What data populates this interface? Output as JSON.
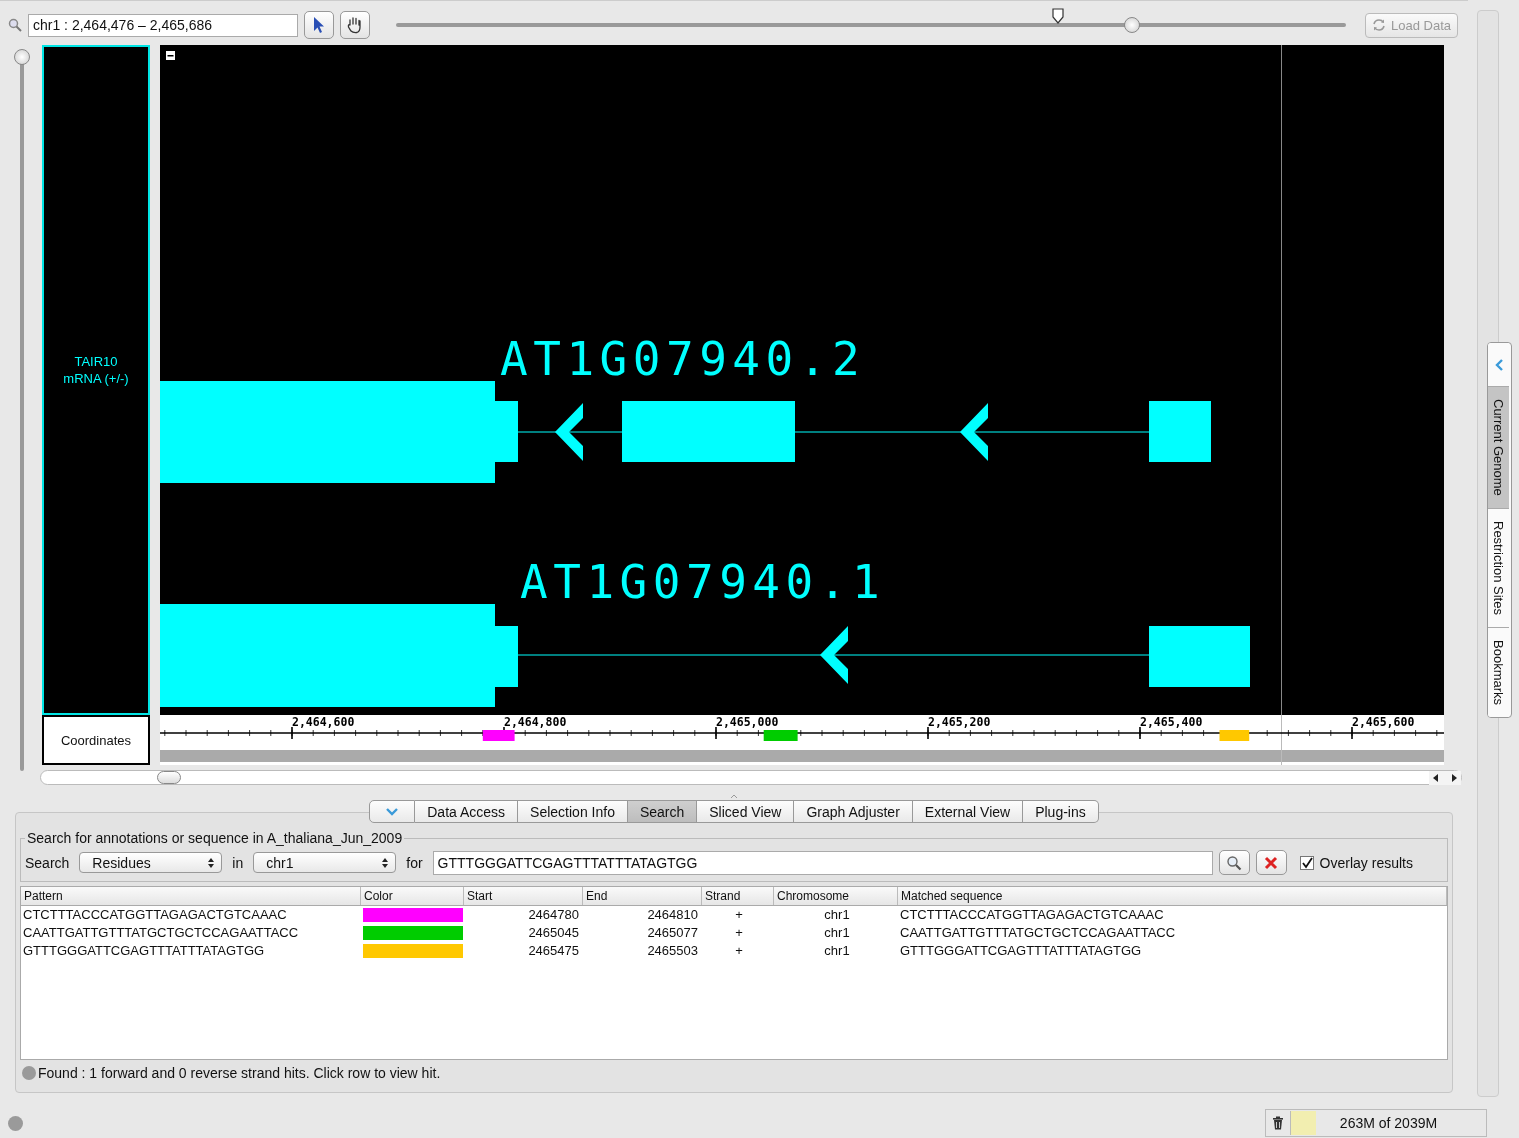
{
  "toolbar": {
    "location": "chr1 : 2,464,476 – 2,465,686",
    "zoom": {
      "level": 0.775
    },
    "load_button": {
      "label": "Load Data",
      "disabled": true
    }
  },
  "vertical_zoom": {
    "level": 0
  },
  "track": {
    "label": "TAIR10 mRNA (+/-)",
    "genes": [
      {
        "label": "AT1G07940.2"
      },
      {
        "label": "AT1G07940.1"
      }
    ]
  },
  "coordinates": {
    "label": "Coordinates",
    "ticks": [
      "2,464,600",
      "2,464,800",
      "2,465,000",
      "2,465,200",
      "2,465,400",
      "2,465,600"
    ]
  },
  "tabs": [
    {
      "label": "Data Access",
      "selected": false
    },
    {
      "label": "Selection Info",
      "selected": false
    },
    {
      "label": "Search",
      "selected": true
    },
    {
      "label": "Sliced View",
      "selected": false
    },
    {
      "label": "Graph Adjuster",
      "selected": false
    },
    {
      "label": "External View",
      "selected": false
    },
    {
      "label": "Plug-ins",
      "selected": false
    }
  ],
  "search": {
    "legend": "Search for annotations or sequence in A_thaliana_Jun_2009",
    "search_label": "Search",
    "type": "Residues",
    "in_label": "in",
    "chromosome": "chr1",
    "for_label": "for",
    "query": "GTTTGGGATTCGAGTTTATTTATAGTGG",
    "overlay": {
      "label": "Overlay results",
      "checked": true
    }
  },
  "results": {
    "columns": [
      "Pattern",
      "Color",
      "Start",
      "End",
      "Strand",
      "Chromosome",
      "Matched sequence"
    ],
    "rows": [
      {
        "pattern": "CTCTTTACCCATGGTTAGAGACTGTCAAAC",
        "color": "#ff00ff",
        "start": "2464780",
        "end": "2464810",
        "strand": "+",
        "chromosome": "chr1",
        "matched": "CTCTTTACCCATGGTTAGAGACTGTCAAAC"
      },
      {
        "pattern": "CAATTGATTGTTTATGCTGCTCCAGAATTACC",
        "color": "#00cc00",
        "start": "2465045",
        "end": "2465077",
        "strand": "+",
        "chromosome": "chr1",
        "matched": "CAATTGATTGTTTATGCTGCTCCAGAATTACC"
      },
      {
        "pattern": "GTTTGGGATTCGAGTTTATTTATAGTGG",
        "color": "#ffc800",
        "start": "2465475",
        "end": "2465503",
        "strand": "+",
        "chromosome": "chr1",
        "matched": "GTTTGGGATTCGAGTTTATTTATAGTGG"
      }
    ]
  },
  "status": "Found : 1 forward and 0 reverse strand hits. Click row to view hit.",
  "side_tabs": [
    {
      "label": "Current Genome",
      "selected": true
    },
    {
      "label": "Restriction Sites",
      "selected": false
    },
    {
      "label": "Bookmarks",
      "selected": false
    }
  ],
  "memory": {
    "level": 0.13,
    "reading": "263M of 2039M"
  }
}
